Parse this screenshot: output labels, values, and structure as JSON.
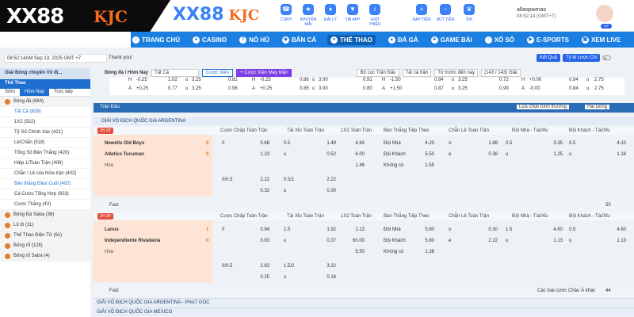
{
  "brand": {
    "left_logo": "XX88",
    "left_kjc": "KJC",
    "right_logo": "XX88",
    "right_kjc": "KJC"
  },
  "topnav": [
    {
      "label": "CSKH",
      "icon": "headset-icon"
    },
    {
      "label": "KHUYẾN MÃI",
      "icon": "gift-icon"
    },
    {
      "label": "ĐẠI LÝ",
      "icon": "agent-icon"
    },
    {
      "label": "TẢI APP",
      "icon": "download-icon"
    },
    {
      "label": "GIỚI THIỆU",
      "icon": "info-icon"
    }
  ],
  "topnav2": [
    {
      "label": "NẠP TIỀN",
      "icon": "deposit-icon"
    },
    {
      "label": "RÚT TIỀN",
      "icon": "withdraw-icon"
    },
    {
      "label": "VIP",
      "icon": "vip-icon"
    }
  ],
  "user": {
    "name": "allaopwmas",
    "time": "08:52:14 (GMT+7)",
    "vip": "VIP"
  },
  "mainnav": [
    {
      "label": "TRANG CHỦ",
      "icon": "home-icon"
    },
    {
      "label": "CASINO",
      "icon": "casino-icon"
    },
    {
      "label": "NỔ HŨ",
      "icon": "slot-icon"
    },
    {
      "label": "BẮN CÁ",
      "icon": "fish-icon"
    },
    {
      "label": "THỂ THAO",
      "icon": "sport-icon"
    },
    {
      "label": "ĐÁ GÀ",
      "icon": "chicken-icon"
    },
    {
      "label": "GAME BÀI",
      "icon": "cards-icon"
    },
    {
      "label": "XỔ SỐ",
      "icon": "lottery-icon"
    },
    {
      "label": "E-SPORTS",
      "icon": "esports-icon"
    },
    {
      "label": "XEM LIVE",
      "icon": "live-icon"
    }
  ],
  "status": {
    "time": "08:52:14AM Sep 13, 2025 GMT +7",
    "message": "Thank you!",
    "result": "Kết Quả",
    "odds": "Tỷ lệ cược CN"
  },
  "sidebar": {
    "header": "Giải Bóng chuyền Vô đị...",
    "sport": "Thể Thao",
    "tabs": [
      "Sớm",
      "Hôm Nay",
      "Trực tiếp"
    ],
    "items": [
      {
        "label": "Bóng đá (684)",
        "sub": false
      },
      {
        "label": "Tất Cả (639)",
        "sub": true,
        "hl": true
      },
      {
        "label": "1X2 (522)",
        "sub": true
      },
      {
        "label": "Tỷ Số Chính Xác (421)",
        "sub": true
      },
      {
        "label": "Lẻ/Chẵn (518)",
        "sub": true
      },
      {
        "label": "Tổng Số Bàn Thắng (420)",
        "sub": true
      },
      {
        "label": "Hiệp 1/Toàn Trận (406)",
        "sub": true
      },
      {
        "label": "Chẵn / Lẻ của Nửa trận (402)",
        "sub": true
      },
      {
        "label": "Bàn thắng Đầu/ Cuối (402)",
        "sub": true,
        "hl": true
      },
      {
        "label": "Cá Cược Tổng Hợp (603)",
        "sub": true
      },
      {
        "label": "Cược Thắng (43)",
        "sub": true
      }
    ],
    "others": [
      "Bóng Đá Saba (36)",
      "Lô tô (11)",
      "Thể Thao Điện Tử (61)",
      "Bóng rổ (128)",
      "Bóng rổ Saba (4)"
    ]
  },
  "filter": {
    "path": "Bóng đá / Hôm Nay",
    "select1": "Tất Cả",
    "btn1": "Cược Xiên",
    "btn2": "+ Cược Xiên May Mắn",
    "select2": "Bộ Lọc Trận Đấu",
    "select3": "Tất cả trận",
    "select4": "Từ trước đến nay",
    "count": "(143 / 143) Giải"
  },
  "prevrows": [
    [
      "H",
      "-0.25",
      "1.02",
      "o",
      "3.25",
      "0.81",
      "H",
      "-0.25",
      "0.86",
      "o",
      "3.00",
      "0.91",
      "H",
      "-1.50",
      "0.84",
      "o",
      "3.25",
      "0.72",
      "H",
      "+0.00",
      "0.94",
      "o",
      "2.75"
    ],
    [
      "A",
      "+0.25",
      "0.77",
      "u",
      "3.25",
      "0.96",
      "A",
      "+0.25",
      "0.85",
      "u",
      "3.00",
      "0.80",
      "A",
      "+1.50",
      "0.87",
      "u",
      "3.25",
      "0.99",
      "A",
      "-0.00",
      "0.84",
      "u",
      "2.75"
    ]
  ],
  "odds_header": {
    "title": "Trận Đấu",
    "select1": "Lựa chọn bình thường",
    "select2": "Hai Dòng"
  },
  "league1": "GIẢI VÔ ĐỊCH QUỐC GIA ARGENTINA",
  "columns": [
    "Cược Chấp Toàn Trận",
    "Tài Xỉu Toàn Trận",
    "1X2 Toàn Trận",
    "Bàn Thắng Tiếp Theo",
    "Chẵn Lẻ Toàn Trận",
    "Đội Nhà - Tài/Xỉu",
    "Đội Khách - Tài/Xỉu"
  ],
  "match1": {
    "live": "2H 29'",
    "home": "Newells Old Boys",
    "away": "Atletico Tucuman",
    "draw": "Hòa",
    "hs": "0",
    "as": "0",
    "r1": {
      "h_l": "0",
      "h_o": "0.68",
      "ou_l": "0.5",
      "ou_o": "1.49",
      "x": "4.84",
      "nl": "Đội Nhà",
      "no": "4.20",
      "ol": "o",
      "oo": "1.88",
      "hl": "0.5",
      "ho": "3.35",
      "al": "0.5",
      "ao": "4.10"
    },
    "r2": {
      "h_o": "1.23",
      "ou_l": "u",
      "ou_o": "0.52",
      "x": "6.00",
      "nl": "Đội Khách",
      "no": "5.50",
      "ol": "e",
      "oo": "0.38",
      "hl": "u",
      "ho": "1.25",
      "al": "u",
      "ao": "1.16"
    },
    "r3": {
      "x": "1.46",
      "nl": "Không có",
      "no": "1.55"
    },
    "r4": {
      "h_l": "0/0.5",
      "h_o": "2.22",
      "ou_l": "0.5/1",
      "ou_o": "2.22"
    },
    "r5": {
      "h_o": "0.32",
      "ou_l": "u",
      "ou_o": "0.30"
    }
  },
  "fast1": {
    "label": "Fast",
    "count": "50"
  },
  "fast2": {
    "label": "Fast",
    "count": "44"
  },
  "other_select": "Các loại cược Châu Á khác",
  "match2": {
    "live": "2H 35'",
    "home": "Lanus",
    "away": "Independiente Rivadavia",
    "draw": "Hòa",
    "hs": "1",
    "as": "0",
    "r1": {
      "h_l": "0",
      "h_o": "0.94",
      "ou_l": "1.5",
      "ou_o": "1.92",
      "x": "1.13",
      "nl": "Đội Nhà",
      "no": "5.80",
      "ol": "o",
      "oo": "0.30",
      "hl": "1.5",
      "ho": "4.60",
      "al": "0.5",
      "ao": "4.60"
    },
    "r2": {
      "h_o": "0.93",
      "ou_l": "u",
      "ou_o": "0.37",
      "x": "60.00",
      "nl": "Đội Khách",
      "no": "5.80",
      "ol": "e",
      "oo": "2.22",
      "hl": "u",
      "ho": "1.13",
      "al": "u",
      "ao": "1.13"
    },
    "r3": {
      "x": "5.50",
      "nl": "Không có",
      "no": "1.38"
    },
    "r4": {
      "h_l": "0/0.5",
      "h_o": "2.63",
      "ou_l": "1.5/2",
      "ou_o": "3.22"
    },
    "r5": {
      "h_o": "0.25",
      "ou_l": "u",
      "ou_o": "0.16"
    }
  },
  "league2": "GIẢI VÔ ĐỊCH QUỐC GIA ARGENTINA - PHẠT GÓC",
  "league3": "GIẢI VÔ ĐỊCH QUỐC GIA MEXICO"
}
